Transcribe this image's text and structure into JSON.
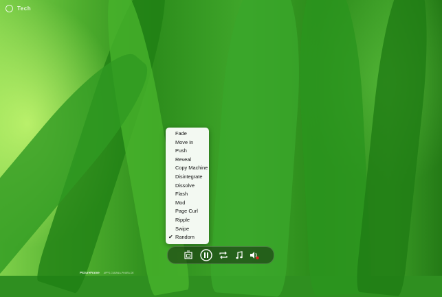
{
  "app": {
    "name": "Tech"
  },
  "transition_menu": {
    "items": [
      {
        "label": "Fade",
        "checked": false
      },
      {
        "label": "Move In",
        "checked": false
      },
      {
        "label": "Push",
        "checked": false
      },
      {
        "label": "Reveal",
        "checked": false
      },
      {
        "label": "Copy Machine",
        "checked": false
      },
      {
        "label": "Disintegrate",
        "checked": false
      },
      {
        "label": "Dissolve",
        "checked": false
      },
      {
        "label": "Flash",
        "checked": false
      },
      {
        "label": "Mod",
        "checked": false
      },
      {
        "label": "Page Curl",
        "checked": false
      },
      {
        "label": "Ripple",
        "checked": false
      },
      {
        "label": "Swipe",
        "checked": false
      },
      {
        "label": "Random",
        "checked": true
      }
    ],
    "check_glyph": "✔"
  },
  "controls": {
    "icons": [
      "slideshow-transition-icon",
      "pause-icon",
      "repeat-icon",
      "music-note-icon",
      "speaker-muted-icon"
    ]
  },
  "footer": {
    "brand": "PictureFrame",
    "url": "APPS.CUBANA-PHARA.DE"
  },
  "colors": {
    "menu_bg": "#FFFFFF",
    "muted_accent": "#E02020"
  }
}
